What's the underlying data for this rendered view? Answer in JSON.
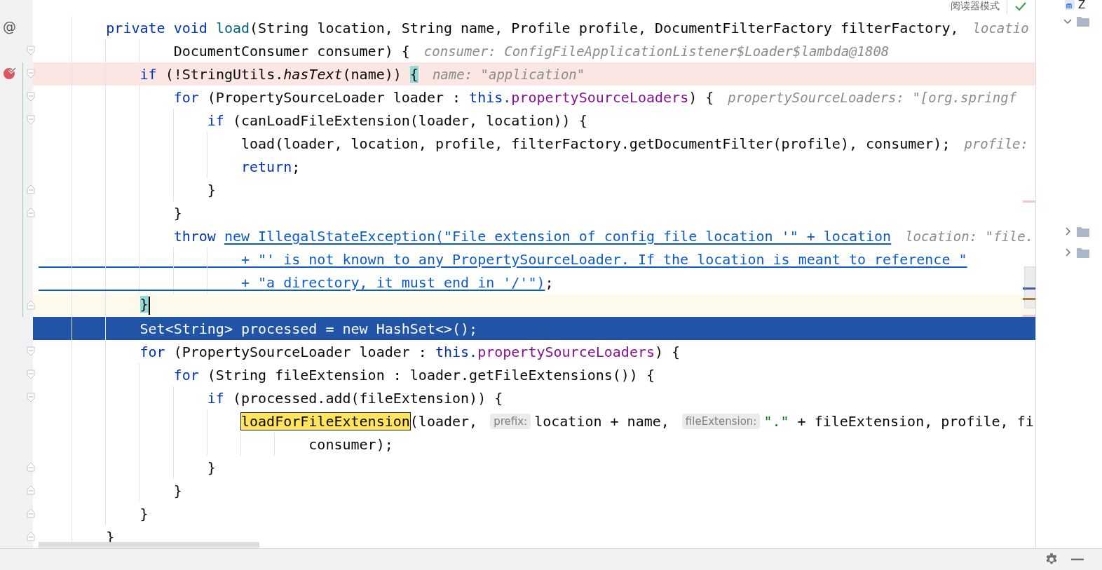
{
  "toolbar": {
    "reader_mode": "阅读器模式"
  },
  "lines": [
    {
      "gutter_text": "@",
      "fold_start": false,
      "fold_end": false,
      "breakpoint": false,
      "current": false,
      "selected": false,
      "tokens": [
        {
          "kind": "keyword",
          "text": "        private void "
        },
        {
          "kind": "method",
          "text": "load"
        },
        {
          "kind": "plain",
          "text": "(String location, String name, Profile profile, DocumentFilterFactory filterFactory,"
        },
        {
          "kind": "hint",
          "text": "locatio"
        }
      ]
    },
    {
      "fold_start": true,
      "fold_end": false,
      "breakpoint": false,
      "current": false,
      "selected": false,
      "tokens": [
        {
          "kind": "plain",
          "text": "                DocumentConsumer consumer) {"
        },
        {
          "kind": "hint",
          "text": "consumer: ConfigFileApplicationListener$Loader$lambda@1808"
        }
      ]
    },
    {
      "fold_start": true,
      "fold_end": false,
      "breakpoint": true,
      "current": false,
      "selected": false,
      "tokens": [
        {
          "kind": "keyword",
          "text": "            if"
        },
        {
          "kind": "plain",
          "text": " (!StringUtils."
        },
        {
          "kind": "italic",
          "text": "hasText"
        },
        {
          "kind": "plain",
          "text": "(name)) "
        },
        {
          "kind": "brace-match",
          "text": "{"
        },
        {
          "kind": "hint",
          "text": "name: \"application\""
        }
      ]
    },
    {
      "fold_start": true,
      "fold_end": false,
      "breakpoint": false,
      "current": false,
      "selected": false,
      "tokens": [
        {
          "kind": "keyword",
          "text": "                for"
        },
        {
          "kind": "plain",
          "text": " (PropertySourceLoader loader : "
        },
        {
          "kind": "keyword",
          "text": "this."
        },
        {
          "kind": "field",
          "text": "propertySourceLoaders"
        },
        {
          "kind": "plain",
          "text": ") {"
        },
        {
          "kind": "hint",
          "text": "propertySourceLoaders: \"[org.springf"
        }
      ]
    },
    {
      "fold_start": true,
      "fold_end": false,
      "breakpoint": false,
      "current": false,
      "selected": false,
      "tokens": [
        {
          "kind": "keyword",
          "text": "                    if"
        },
        {
          "kind": "plain",
          "text": " (canLoadFileExtension(loader, location)) {"
        }
      ]
    },
    {
      "fold_start": false,
      "fold_end": false,
      "breakpoint": false,
      "current": false,
      "selected": false,
      "tokens": [
        {
          "kind": "plain",
          "text": "                        load(loader, location, profile, filterFactory.getDocumentFilter(profile), consumer);"
        },
        {
          "kind": "hint",
          "text": "profile:"
        }
      ]
    },
    {
      "fold_start": false,
      "fold_end": false,
      "breakpoint": false,
      "current": false,
      "selected": false,
      "tokens": [
        {
          "kind": "keyword",
          "text": "                        return"
        },
        {
          "kind": "plain",
          "text": ";"
        }
      ]
    },
    {
      "fold_start": false,
      "fold_end": true,
      "breakpoint": false,
      "current": false,
      "selected": false,
      "tokens": [
        {
          "kind": "plain",
          "text": "                    }"
        }
      ]
    },
    {
      "fold_start": false,
      "fold_end": true,
      "breakpoint": false,
      "current": false,
      "selected": false,
      "tokens": [
        {
          "kind": "plain",
          "text": "                }"
        }
      ]
    },
    {
      "fold_start": false,
      "fold_end": false,
      "breakpoint": false,
      "current": false,
      "selected": false,
      "tokens": [
        {
          "kind": "keyword",
          "text": "                throw "
        },
        {
          "kind": "link",
          "text": "new IllegalStateException(\"File extension of config file location '\" + location"
        },
        {
          "kind": "hint",
          "text": "location: \"file."
        }
      ]
    },
    {
      "fold_start": false,
      "fold_end": false,
      "breakpoint": false,
      "current": false,
      "selected": false,
      "tokens": [
        {
          "kind": "link",
          "text": "                        + \"' is not known to any PropertySourceLoader. If the location is meant to reference \""
        }
      ]
    },
    {
      "fold_start": false,
      "fold_end": false,
      "breakpoint": false,
      "current": false,
      "selected": false,
      "tokens": [
        {
          "kind": "link",
          "text": "                        + \"a directory, it must end in '/'\")"
        },
        {
          "kind": "plain",
          "text": ";"
        }
      ]
    },
    {
      "fold_start": false,
      "fold_end": true,
      "breakpoint": false,
      "current": true,
      "selected": false,
      "tokens": [
        {
          "kind": "brace-match",
          "text": "            }"
        }
      ]
    },
    {
      "fold_start": false,
      "fold_end": false,
      "breakpoint": false,
      "current": false,
      "selected": true,
      "tokens": [
        {
          "kind": "plain",
          "text": "            Set<String> processed = new HashSet<>();"
        }
      ]
    },
    {
      "fold_start": true,
      "fold_end": false,
      "breakpoint": false,
      "current": false,
      "selected": false,
      "tokens": [
        {
          "kind": "keyword",
          "text": "            for"
        },
        {
          "kind": "plain",
          "text": " (PropertySourceLoader loader : "
        },
        {
          "kind": "keyword",
          "text": "this."
        },
        {
          "kind": "field",
          "text": "propertySourceLoaders"
        },
        {
          "kind": "plain",
          "text": ") {"
        }
      ]
    },
    {
      "fold_start": true,
      "fold_end": false,
      "breakpoint": false,
      "current": false,
      "selected": false,
      "tokens": [
        {
          "kind": "keyword",
          "text": "                for"
        },
        {
          "kind": "plain",
          "text": " (String fileExtension : loader.getFileExtensions()) {"
        }
      ]
    },
    {
      "fold_start": true,
      "fold_end": false,
      "breakpoint": false,
      "current": false,
      "selected": false,
      "tokens": [
        {
          "kind": "keyword",
          "text": "                    if"
        },
        {
          "kind": "plain",
          "text": " (processed.add(fileExtension)) {"
        }
      ]
    },
    {
      "fold_start": false,
      "fold_end": false,
      "breakpoint": false,
      "current": false,
      "selected": false,
      "tokens": [
        {
          "kind": "search-match",
          "text": "                        loadForFileExtension"
        },
        {
          "kind": "plain",
          "text": "(loader, "
        },
        {
          "kind": "param-hint",
          "text": "prefix:"
        },
        {
          "kind": "plain",
          "text": "location + name, "
        },
        {
          "kind": "param-hint",
          "text": "fileExtension:"
        },
        {
          "kind": "string",
          "text": "\".\""
        },
        {
          "kind": "plain",
          "text": " + fileExtension, profile, fi"
        }
      ]
    },
    {
      "fold_start": false,
      "fold_end": false,
      "breakpoint": false,
      "current": false,
      "selected": false,
      "tokens": [
        {
          "kind": "plain",
          "text": "                                consumer);"
        }
      ]
    },
    {
      "fold_start": false,
      "fold_end": true,
      "breakpoint": false,
      "current": false,
      "selected": false,
      "tokens": [
        {
          "kind": "plain",
          "text": "                    }"
        }
      ]
    },
    {
      "fold_start": false,
      "fold_end": true,
      "breakpoint": false,
      "current": false,
      "selected": false,
      "tokens": [
        {
          "kind": "plain",
          "text": "                }"
        }
      ]
    },
    {
      "fold_start": false,
      "fold_end": true,
      "breakpoint": false,
      "current": false,
      "selected": false,
      "tokens": [
        {
          "kind": "plain",
          "text": "            }"
        }
      ]
    },
    {
      "fold_start": false,
      "fold_end": true,
      "breakpoint": false,
      "current": false,
      "selected": false,
      "tokens": [
        {
          "kind": "plain",
          "text": "        }"
        }
      ]
    }
  ],
  "project_tree": {
    "title": "Z",
    "items": [
      {
        "expanded": true
      },
      {
        "expanded": false
      },
      {
        "expanded": false
      }
    ]
  }
}
